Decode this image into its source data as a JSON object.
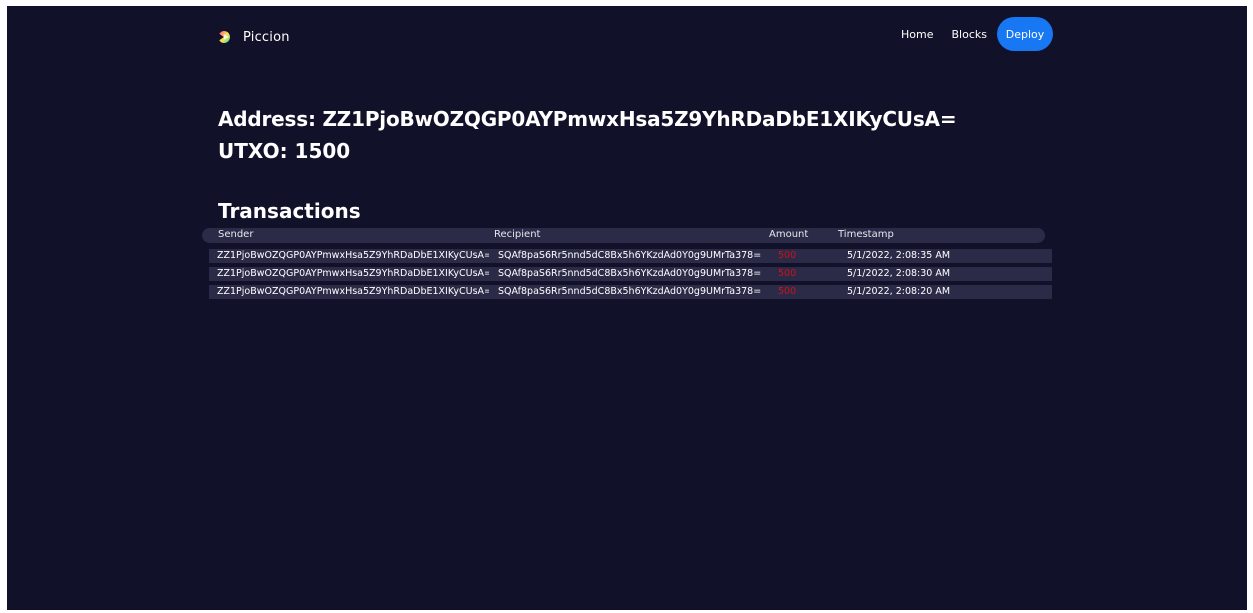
{
  "brand": {
    "name": "Piccion",
    "icon": "piccion-logo-icon"
  },
  "nav": {
    "home": "Home",
    "blocks": "Blocks",
    "deploy": "Deploy"
  },
  "colors": {
    "background": "#12112a",
    "accent": "#1877f2",
    "amount": "#d0101b",
    "row_bg": "#2b2b48"
  },
  "wallet": {
    "address_line": "Address: ZZ1PjoBwOZQGP0AYPmwxHsa5Z9YhRDaDbE1XIKyCUsA=",
    "utxo_line": "UTXO: 1500"
  },
  "transactions": {
    "title": "Transactions",
    "columns": {
      "sender": "Sender",
      "recipient": "Recipient",
      "amount": "Amount",
      "timestamp": "Timestamp"
    },
    "rows": [
      {
        "sender": "ZZ1PjoBwOZQGP0AYPmwxHsa5Z9YhRDaDbE1XIKyCUsA=",
        "recipient": "SQAf8paS6Rr5nnd5dC8Bx5h6YKzdAd0Y0g9UMrTa378=",
        "amount": "500",
        "timestamp": "5/1/2022, 2:08:35 AM"
      },
      {
        "sender": "ZZ1PjoBwOZQGP0AYPmwxHsa5Z9YhRDaDbE1XIKyCUsA=",
        "recipient": "SQAf8paS6Rr5nnd5dC8Bx5h6YKzdAd0Y0g9UMrTa378=",
        "amount": "500",
        "timestamp": "5/1/2022, 2:08:30 AM"
      },
      {
        "sender": "ZZ1PjoBwOZQGP0AYPmwxHsa5Z9YhRDaDbE1XIKyCUsA=",
        "recipient": "SQAf8paS6Rr5nnd5dC8Bx5h6YKzdAd0Y0g9UMrTa378=",
        "amount": "500",
        "timestamp": "5/1/2022, 2:08:20 AM"
      }
    ]
  }
}
